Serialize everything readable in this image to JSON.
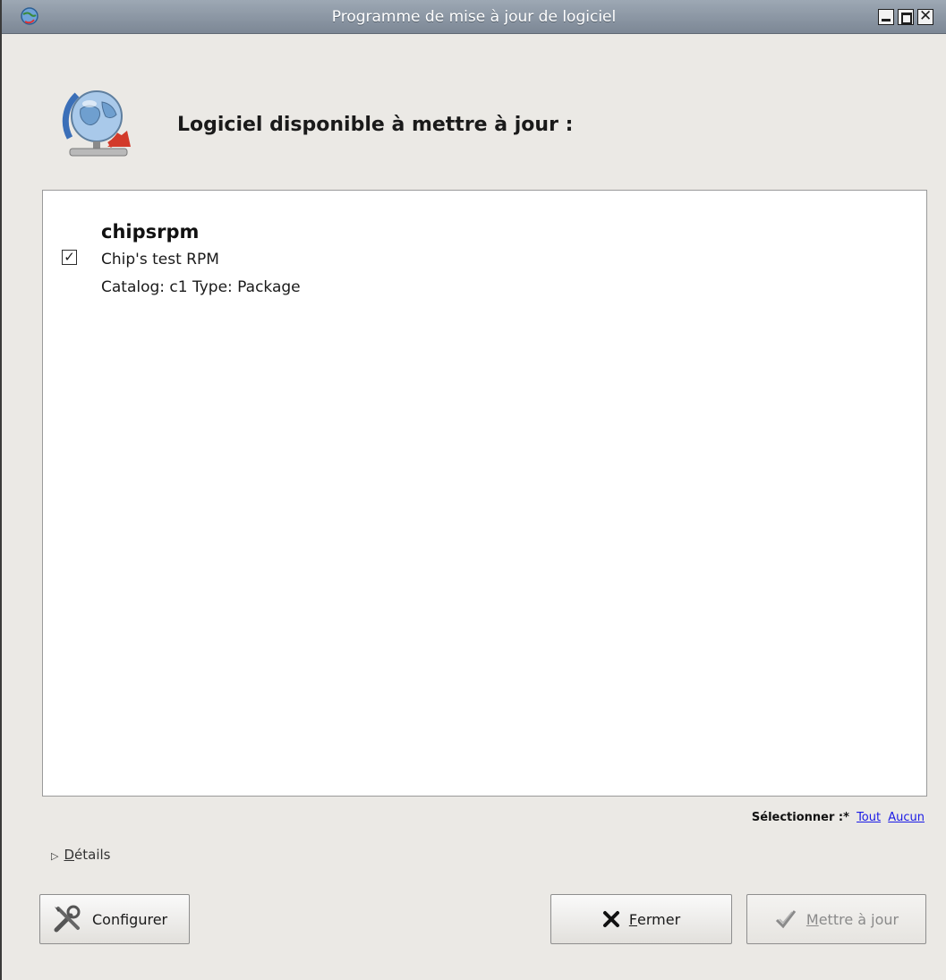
{
  "window": {
    "title": "Programme de mise à jour de logiciel"
  },
  "header": {
    "title": "Logiciel disponible à mettre à jour :"
  },
  "updates": [
    {
      "name": "chipsrpm",
      "description": "Chip's test RPM",
      "meta": "Catalog: c1 Type: Package",
      "checked": true
    }
  ],
  "select": {
    "label": "Sélectionner :*",
    "all": "Tout",
    "none": "Aucun"
  },
  "details": {
    "label_first": "D",
    "label_rest": "étails"
  },
  "buttons": {
    "configure": "Configurer",
    "close_first": "F",
    "close_rest": "ermer",
    "update_first": "M",
    "update_rest": "ettre à jour"
  },
  "icons": {
    "app": "update-globe-icon",
    "header": "update-globe-icon",
    "configure": "tools-icon",
    "close": "close-x-icon",
    "update": "checkmark-icon"
  }
}
